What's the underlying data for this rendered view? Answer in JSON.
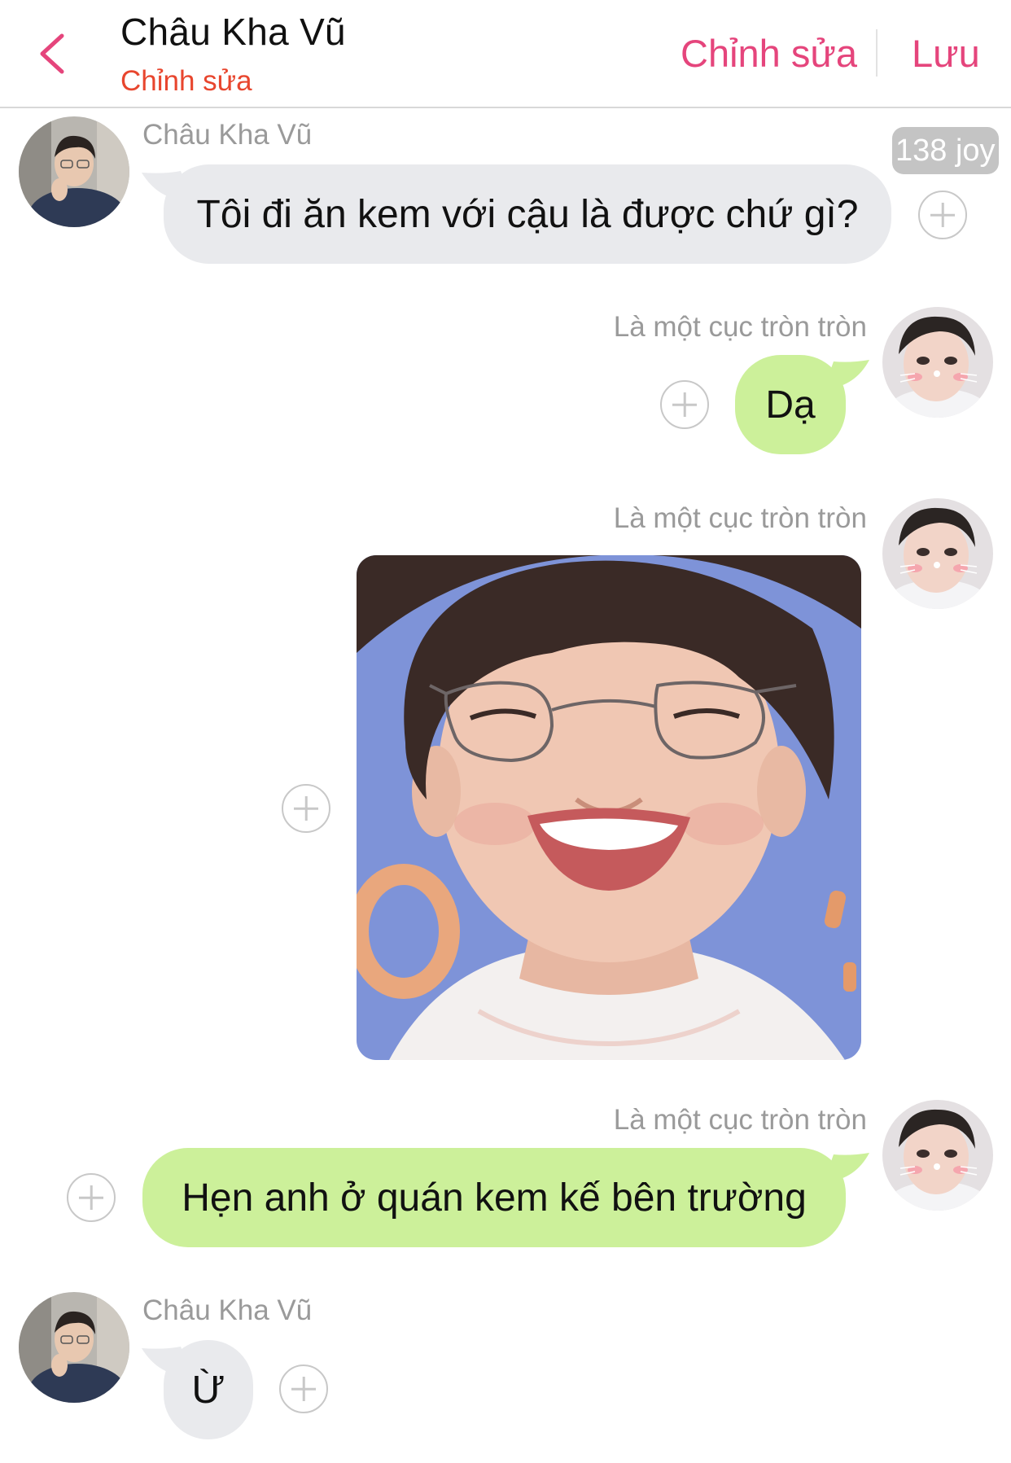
{
  "header": {
    "title": "Châu Kha Vũ",
    "subtitle": "Chỉnh sửa",
    "edit_label": "Chỉnh sửa",
    "save_label": "Lưu",
    "back_icon": "chevron-left-icon",
    "accent_color": "#e5457c"
  },
  "contacts": {
    "other_name": "Châu Kha Vũ",
    "self_name": "Là một cục tròn tròn"
  },
  "messages": [
    {
      "sender": "Châu Kha Vũ",
      "side": "left",
      "type": "text",
      "text": "Tôi đi ăn kem với cậu là được chứ gì?",
      "badge": "138 joy"
    },
    {
      "sender": "Là một cục tròn tròn",
      "side": "right",
      "type": "text",
      "text": "Dạ"
    },
    {
      "sender": "Là một cục tròn tròn",
      "side": "right",
      "type": "image",
      "image_icon": "selfie-photo"
    },
    {
      "sender": "Là một cục tròn tròn",
      "side": "right",
      "type": "text",
      "text": "Hẹn anh ở quán kem kế bên trường"
    },
    {
      "sender": "Châu Kha Vũ",
      "side": "left",
      "type": "text",
      "text": "Ừ"
    }
  ],
  "colors": {
    "incoming_bubble": "#e9eaed",
    "outgoing_bubble": "#ccf09a",
    "name_text": "#9a9a9a",
    "subtitle": "#e8462e"
  },
  "icons": {
    "add": "plus-circle-icon"
  }
}
